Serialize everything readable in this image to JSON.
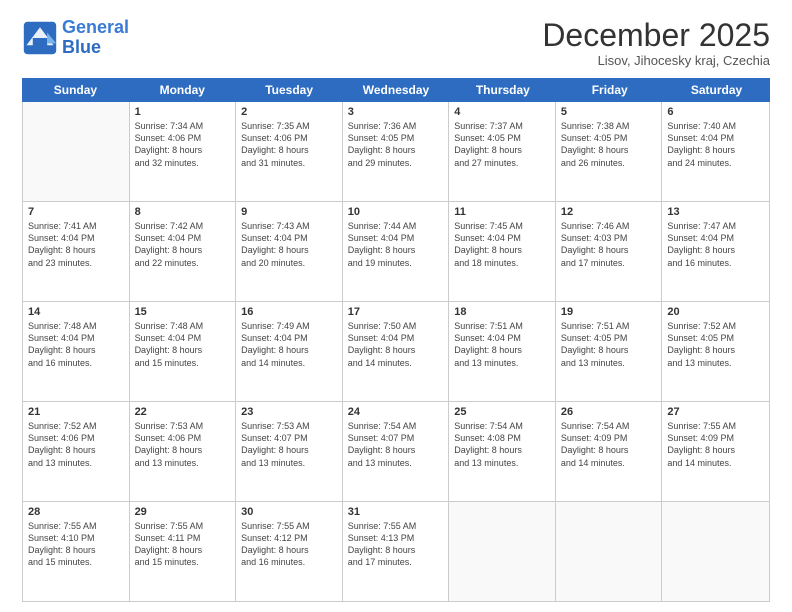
{
  "logo": {
    "line1": "General",
    "line2": "Blue"
  },
  "title": "December 2025",
  "subtitle": "Lisov, Jihocesky kraj, Czechia",
  "days": [
    "Sunday",
    "Monday",
    "Tuesday",
    "Wednesday",
    "Thursday",
    "Friday",
    "Saturday"
  ],
  "weeks": [
    [
      {
        "num": "",
        "sunrise": "",
        "sunset": "",
        "daylight": ""
      },
      {
        "num": "1",
        "sunrise": "Sunrise: 7:34 AM",
        "sunset": "Sunset: 4:06 PM",
        "daylight": "Daylight: 8 hours and 32 minutes."
      },
      {
        "num": "2",
        "sunrise": "Sunrise: 7:35 AM",
        "sunset": "Sunset: 4:06 PM",
        "daylight": "Daylight: 8 hours and 31 minutes."
      },
      {
        "num": "3",
        "sunrise": "Sunrise: 7:36 AM",
        "sunset": "Sunset: 4:05 PM",
        "daylight": "Daylight: 8 hours and 29 minutes."
      },
      {
        "num": "4",
        "sunrise": "Sunrise: 7:37 AM",
        "sunset": "Sunset: 4:05 PM",
        "daylight": "Daylight: 8 hours and 27 minutes."
      },
      {
        "num": "5",
        "sunrise": "Sunrise: 7:38 AM",
        "sunset": "Sunset: 4:05 PM",
        "daylight": "Daylight: 8 hours and 26 minutes."
      },
      {
        "num": "6",
        "sunrise": "Sunrise: 7:40 AM",
        "sunset": "Sunset: 4:04 PM",
        "daylight": "Daylight: 8 hours and 24 minutes."
      }
    ],
    [
      {
        "num": "7",
        "sunrise": "Sunrise: 7:41 AM",
        "sunset": "Sunset: 4:04 PM",
        "daylight": "Daylight: 8 hours and 23 minutes."
      },
      {
        "num": "8",
        "sunrise": "Sunrise: 7:42 AM",
        "sunset": "Sunset: 4:04 PM",
        "daylight": "Daylight: 8 hours and 22 minutes."
      },
      {
        "num": "9",
        "sunrise": "Sunrise: 7:43 AM",
        "sunset": "Sunset: 4:04 PM",
        "daylight": "Daylight: 8 hours and 20 minutes."
      },
      {
        "num": "10",
        "sunrise": "Sunrise: 7:44 AM",
        "sunset": "Sunset: 4:04 PM",
        "daylight": "Daylight: 8 hours and 19 minutes."
      },
      {
        "num": "11",
        "sunrise": "Sunrise: 7:45 AM",
        "sunset": "Sunset: 4:04 PM",
        "daylight": "Daylight: 8 hours and 18 minutes."
      },
      {
        "num": "12",
        "sunrise": "Sunrise: 7:46 AM",
        "sunset": "Sunset: 4:03 PM",
        "daylight": "Daylight: 8 hours and 17 minutes."
      },
      {
        "num": "13",
        "sunrise": "Sunrise: 7:47 AM",
        "sunset": "Sunset: 4:04 PM",
        "daylight": "Daylight: 8 hours and 16 minutes."
      }
    ],
    [
      {
        "num": "14",
        "sunrise": "Sunrise: 7:48 AM",
        "sunset": "Sunset: 4:04 PM",
        "daylight": "Daylight: 8 hours and 16 minutes."
      },
      {
        "num": "15",
        "sunrise": "Sunrise: 7:48 AM",
        "sunset": "Sunset: 4:04 PM",
        "daylight": "Daylight: 8 hours and 15 minutes."
      },
      {
        "num": "16",
        "sunrise": "Sunrise: 7:49 AM",
        "sunset": "Sunset: 4:04 PM",
        "daylight": "Daylight: 8 hours and 14 minutes."
      },
      {
        "num": "17",
        "sunrise": "Sunrise: 7:50 AM",
        "sunset": "Sunset: 4:04 PM",
        "daylight": "Daylight: 8 hours and 14 minutes."
      },
      {
        "num": "18",
        "sunrise": "Sunrise: 7:51 AM",
        "sunset": "Sunset: 4:04 PM",
        "daylight": "Daylight: 8 hours and 13 minutes."
      },
      {
        "num": "19",
        "sunrise": "Sunrise: 7:51 AM",
        "sunset": "Sunset: 4:05 PM",
        "daylight": "Daylight: 8 hours and 13 minutes."
      },
      {
        "num": "20",
        "sunrise": "Sunrise: 7:52 AM",
        "sunset": "Sunset: 4:05 PM",
        "daylight": "Daylight: 8 hours and 13 minutes."
      }
    ],
    [
      {
        "num": "21",
        "sunrise": "Sunrise: 7:52 AM",
        "sunset": "Sunset: 4:06 PM",
        "daylight": "Daylight: 8 hours and 13 minutes."
      },
      {
        "num": "22",
        "sunrise": "Sunrise: 7:53 AM",
        "sunset": "Sunset: 4:06 PM",
        "daylight": "Daylight: 8 hours and 13 minutes."
      },
      {
        "num": "23",
        "sunrise": "Sunrise: 7:53 AM",
        "sunset": "Sunset: 4:07 PM",
        "daylight": "Daylight: 8 hours and 13 minutes."
      },
      {
        "num": "24",
        "sunrise": "Sunrise: 7:54 AM",
        "sunset": "Sunset: 4:07 PM",
        "daylight": "Daylight: 8 hours and 13 minutes."
      },
      {
        "num": "25",
        "sunrise": "Sunrise: 7:54 AM",
        "sunset": "Sunset: 4:08 PM",
        "daylight": "Daylight: 8 hours and 13 minutes."
      },
      {
        "num": "26",
        "sunrise": "Sunrise: 7:54 AM",
        "sunset": "Sunset: 4:09 PM",
        "daylight": "Daylight: 8 hours and 14 minutes."
      },
      {
        "num": "27",
        "sunrise": "Sunrise: 7:55 AM",
        "sunset": "Sunset: 4:09 PM",
        "daylight": "Daylight: 8 hours and 14 minutes."
      }
    ],
    [
      {
        "num": "28",
        "sunrise": "Sunrise: 7:55 AM",
        "sunset": "Sunset: 4:10 PM",
        "daylight": "Daylight: 8 hours and 15 minutes."
      },
      {
        "num": "29",
        "sunrise": "Sunrise: 7:55 AM",
        "sunset": "Sunset: 4:11 PM",
        "daylight": "Daylight: 8 hours and 15 minutes."
      },
      {
        "num": "30",
        "sunrise": "Sunrise: 7:55 AM",
        "sunset": "Sunset: 4:12 PM",
        "daylight": "Daylight: 8 hours and 16 minutes."
      },
      {
        "num": "31",
        "sunrise": "Sunrise: 7:55 AM",
        "sunset": "Sunset: 4:13 PM",
        "daylight": "Daylight: 8 hours and 17 minutes."
      },
      {
        "num": "",
        "sunrise": "",
        "sunset": "",
        "daylight": ""
      },
      {
        "num": "",
        "sunrise": "",
        "sunset": "",
        "daylight": ""
      },
      {
        "num": "",
        "sunrise": "",
        "sunset": "",
        "daylight": ""
      }
    ]
  ]
}
